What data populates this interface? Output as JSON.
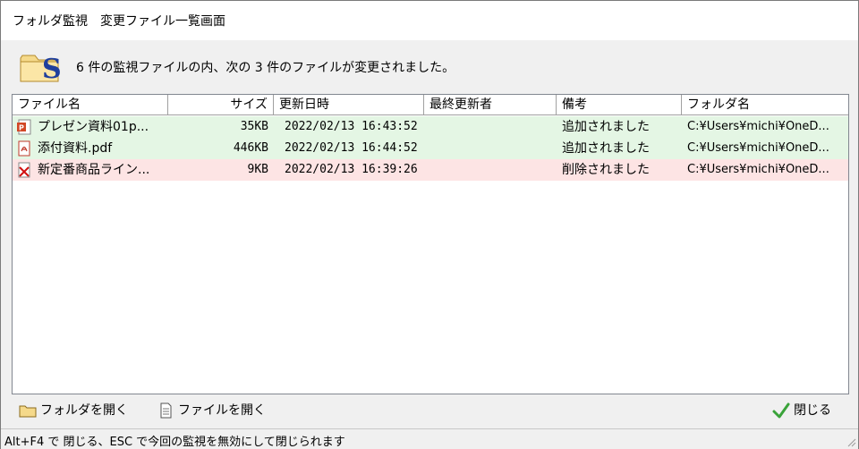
{
  "window": {
    "title": "フォルダ監視　変更ファイル一覧画面"
  },
  "header": {
    "message": "6 件の監視ファイルの内、次の 3 件のファイルが変更されました。"
  },
  "columns": {
    "name": "ファイル名",
    "size": "サイズ",
    "modified": "更新日時",
    "last_modified_by": "最終更新者",
    "note": "備考",
    "folder": "フォルダ名"
  },
  "rows": [
    {
      "icon": "powerpoint-file-icon",
      "name": "プレゼン資料01p...",
      "size": "35KB",
      "modified": "2022/02/13 16:43:52",
      "last_modified_by": "",
      "note": "追加されました",
      "folder": "C:¥Users¥michi¥OneD...",
      "status": "added"
    },
    {
      "icon": "pdf-file-icon",
      "name": "添付資料.pdf",
      "size": "446KB",
      "modified": "2022/02/13 16:44:52",
      "last_modified_by": "",
      "note": "追加されました",
      "folder": "C:¥Users¥michi¥OneD...",
      "status": "added"
    },
    {
      "icon": "deleted-file-icon",
      "name": "新定番商品ライン...",
      "size": "9KB",
      "modified": "2022/02/13 16:39:26",
      "last_modified_by": "",
      "note": "削除されました",
      "folder": "C:¥Users¥michi¥OneD...",
      "status": "deleted"
    }
  ],
  "toolbar": {
    "open_folder": "フォルダを開く",
    "open_file": "ファイルを開く",
    "close": "閉じる"
  },
  "statusbar": {
    "text": "Alt+F4 で 閉じる、ESC で今回の監視を無効にして閉じられます"
  },
  "colors": {
    "added_row": "#e4f6e4",
    "deleted_row": "#fde4e4"
  }
}
